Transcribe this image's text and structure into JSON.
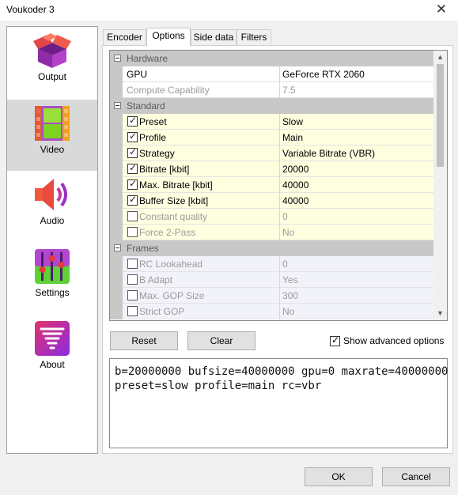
{
  "window": {
    "title": "Voukoder 3",
    "close_glyph": "✕"
  },
  "sidebar": {
    "items": [
      {
        "label": "Output",
        "icon": "box-icon"
      },
      {
        "label": "Video",
        "icon": "film-icon"
      },
      {
        "label": "Audio",
        "icon": "speaker-icon"
      },
      {
        "label": "Settings",
        "icon": "sliders-icon"
      },
      {
        "label": "About",
        "icon": "tornado-icon"
      }
    ],
    "active": "Video"
  },
  "tabs": [
    "Encoder",
    "Options",
    "Side data",
    "Filters"
  ],
  "active_tab": "Options",
  "grid": {
    "categories": {
      "hardware": "Hardware",
      "standard": "Standard",
      "frames": "Frames"
    },
    "rows": [
      {
        "name": "GPU",
        "value": "GeForce RTX 2060"
      },
      {
        "name": "Compute Capability",
        "value": "7.5"
      },
      {
        "name": "Preset",
        "value": "Slow",
        "checked": true
      },
      {
        "name": "Profile",
        "value": "Main",
        "checked": true
      },
      {
        "name": "Strategy",
        "value": "Variable Bitrate (VBR)",
        "checked": true
      },
      {
        "name": "Bitrate [kbit]",
        "value": "20000",
        "checked": true
      },
      {
        "name": "Max. Bitrate [kbit]",
        "value": "40000",
        "checked": true
      },
      {
        "name": "Buffer Size [kbit]",
        "value": "40000",
        "checked": true
      },
      {
        "name": "Constant quality",
        "value": "0",
        "checked": false
      },
      {
        "name": "Force 2-Pass",
        "value": "No",
        "checked": false
      },
      {
        "name": "RC Lookahead",
        "value": "0",
        "checked": false
      },
      {
        "name": "B Adapt",
        "value": "Yes",
        "checked": false
      },
      {
        "name": "Max. GOP Size",
        "value": "300",
        "checked": false
      },
      {
        "name": "Strict GOP",
        "value": "No",
        "checked": false
      }
    ]
  },
  "buttons": {
    "reset": "Reset",
    "clear": "Clear",
    "ok": "OK",
    "cancel": "Cancel"
  },
  "show_advanced": {
    "label": "Show advanced options",
    "checked": true
  },
  "command": {
    "line1": "b=20000000 bufsize=40000000 gpu=0 maxrate=40000000",
    "line2": "preset=slow profile=main rc=vbr"
  }
}
